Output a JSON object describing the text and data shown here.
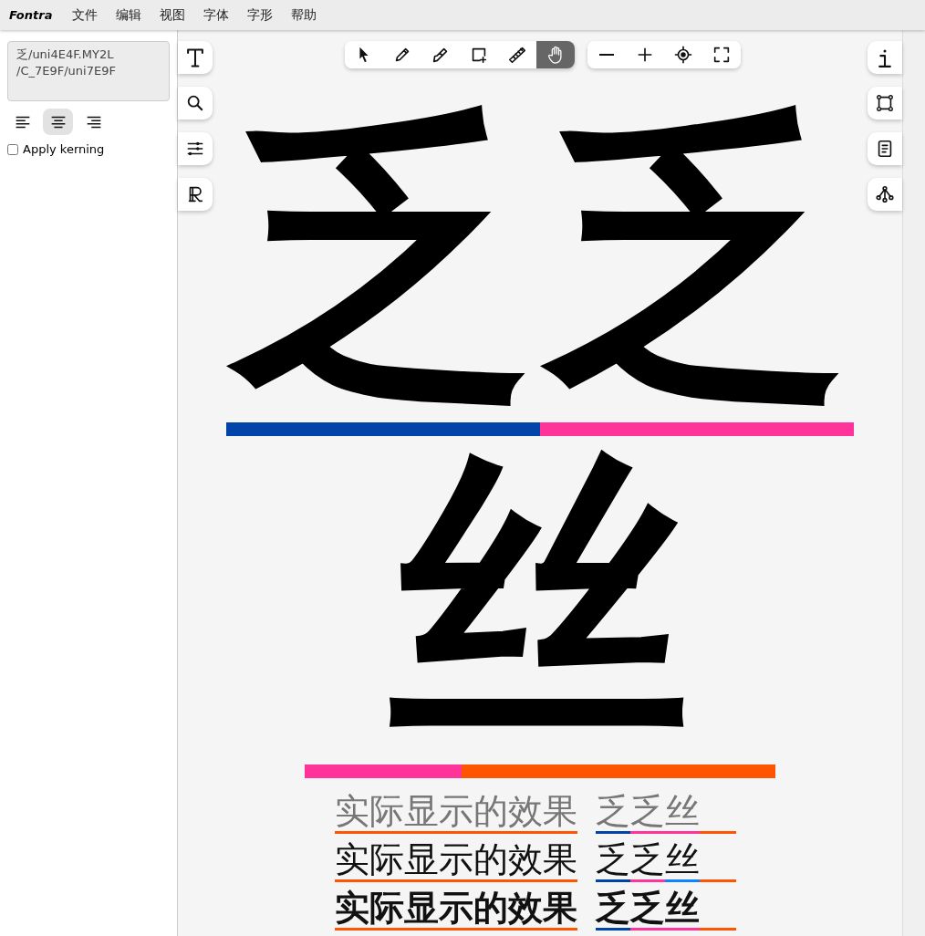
{
  "menu_bar": {
    "logo": "Fontra",
    "items": [
      "文件",
      "编辑",
      "视图",
      "字体",
      "字形",
      "帮助"
    ]
  },
  "sidebar": {
    "glyph_text": "乏/uni4E4F.MY2L\n/C_7E9F/uni7E9F",
    "align_buttons": [
      {
        "kind": "left",
        "selected": false
      },
      {
        "kind": "center",
        "selected": true
      },
      {
        "kind": "right",
        "selected": false
      }
    ],
    "apply_kerning": {
      "label": "Apply kerning",
      "checked": false
    }
  },
  "left_tools": [
    {
      "kind": "text"
    },
    {
      "kind": "search"
    },
    {
      "kind": "sliders"
    },
    {
      "kind": "references"
    }
  ],
  "edit_tools": [
    {
      "kind": "pointer",
      "selected": false
    },
    {
      "kind": "pen",
      "selected": false
    },
    {
      "kind": "knife",
      "selected": false
    },
    {
      "kind": "shape",
      "selected": false
    },
    {
      "kind": "ruler",
      "selected": false
    },
    {
      "kind": "hand",
      "selected": true
    }
  ],
  "zoom_tools": [
    {
      "kind": "zoom-out"
    },
    {
      "kind": "zoom-in"
    },
    {
      "kind": "locate"
    },
    {
      "kind": "fit"
    }
  ],
  "right_tools": [
    {
      "kind": "info"
    },
    {
      "kind": "transform"
    },
    {
      "kind": "notes"
    },
    {
      "kind": "tree"
    }
  ],
  "canvas": {
    "lines": [
      {
        "glyphs": [
          {
            "char": "乏",
            "bars": [
              {
                "color": "#0044aa"
              }
            ]
          },
          {
            "char": "乏",
            "bars": [
              {
                "color": "#ff3399"
              }
            ]
          }
        ]
      },
      {
        "glyphs": [
          {
            "char": "丝",
            "bars": [
              {
                "color": "#ff3399"
              },
              {
                "color": "#ff5500"
              },
              {
                "color": "#ff5500"
              }
            ]
          }
        ]
      }
    ],
    "samples": [
      {
        "kind": "light",
        "text": "实际显示的效果",
        "color": "#ff5500",
        "glyphs": [
          {
            "char": "乏",
            "color": "#0044aa"
          },
          {
            "char": "乏",
            "color": "#ff3399"
          },
          {
            "char": "丝",
            "color": "#ff3399"
          }
        ],
        "tail": {
          "color": "#ff5500"
        }
      },
      {
        "kind": "regular",
        "text": "实际显示的效果",
        "color": "#ff5500",
        "glyphs": [
          {
            "char": "乏",
            "color": "#0044aa"
          },
          {
            "char": "乏",
            "color": "#ff3399"
          },
          {
            "char": "丝",
            "color": "#0a84ff"
          }
        ],
        "tail": {
          "color": "#ff5500"
        }
      },
      {
        "kind": "bold",
        "text": "实际显示的效果",
        "color": "#ff5500",
        "glyphs": [
          {
            "char": "乏",
            "color": "#0044aa"
          },
          {
            "char": "乏",
            "color": "#ff3399"
          },
          {
            "char": "丝",
            "color": "#ff3399"
          }
        ],
        "tail": {
          "color": "#ff5500"
        }
      }
    ]
  }
}
